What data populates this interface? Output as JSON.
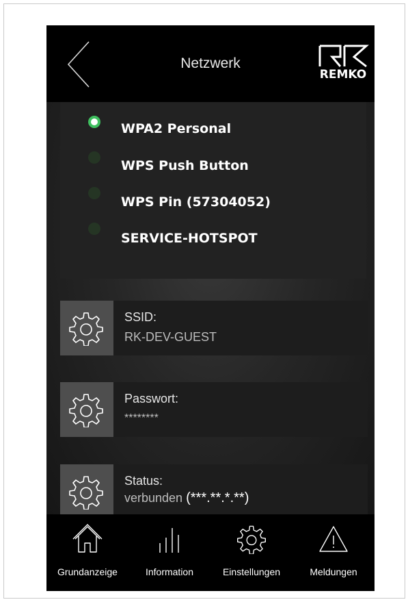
{
  "header": {
    "title": "Netzwerk",
    "logo_text": "REMKO"
  },
  "network_modes": [
    {
      "label": "WPA2 Personal",
      "selected": true
    },
    {
      "label": "WPS Push Button",
      "selected": false
    },
    {
      "label": "WPS Pin (57304052)",
      "selected": false
    },
    {
      "label": "SERVICE-HOTSPOT",
      "selected": false
    }
  ],
  "settings": {
    "ssid": {
      "label": "SSID:",
      "value": "RK-DEV-GUEST"
    },
    "password": {
      "label": "Passwort:",
      "value": "********"
    },
    "status": {
      "label": "Status:",
      "value": "verbunden",
      "ip": "(***.**.*.**)"
    }
  },
  "bottom_nav": [
    {
      "label": "Grundanzeige",
      "icon": "home-icon"
    },
    {
      "label": "Information",
      "icon": "bar-chart-icon"
    },
    {
      "label": "Einstellungen",
      "icon": "gear-icon"
    },
    {
      "label": "Meldungen",
      "icon": "warning-icon"
    }
  ],
  "colors": {
    "selected_radio": "#3fbf5f",
    "unselected_radio": "#253524",
    "header_bg": "#000000"
  }
}
